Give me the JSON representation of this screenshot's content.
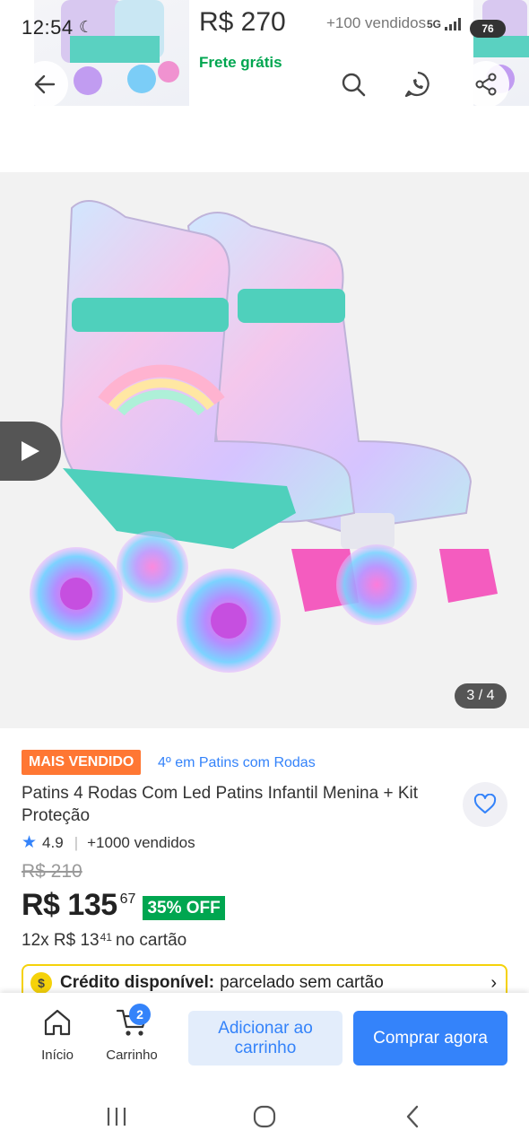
{
  "status_bar": {
    "time": "12:54",
    "network": "5G",
    "battery": "76"
  },
  "header": {
    "price": "R$ 270",
    "sold": "+100 vendidos",
    "shipping": "Frete grátis"
  },
  "gallery": {
    "counter": "3 / 4"
  },
  "product": {
    "badge": "MAIS VENDIDO",
    "ranking": "4º em Patins com Rodas",
    "title": "Patins 4 Rodas Com Led Patins Infantil Menina + Kit Proteção",
    "rating": "4.9",
    "sold": "+1000 vendidos",
    "old_price": "R$ 210",
    "price": "R$ 135",
    "price_cents": "67",
    "discount": "35% OFF",
    "installments_prefix": "12x R$ 13",
    "installments_cents": "41",
    "installments_suffix": "no cartão"
  },
  "credit": {
    "label": "Crédito disponível:",
    "text": "parcelado sem cartão",
    "coin_symbol": "$"
  },
  "bottom_bar": {
    "home_label": "Início",
    "cart_label": "Carrinho",
    "cart_count": "2",
    "add_label": "Adicionar ao carrinho",
    "buy_label": "Comprar agora"
  },
  "colors": {
    "accent": "#3483fa",
    "green": "#00a650",
    "badge_orange": "#ff7733",
    "credit_yellow": "#f5d20a"
  }
}
